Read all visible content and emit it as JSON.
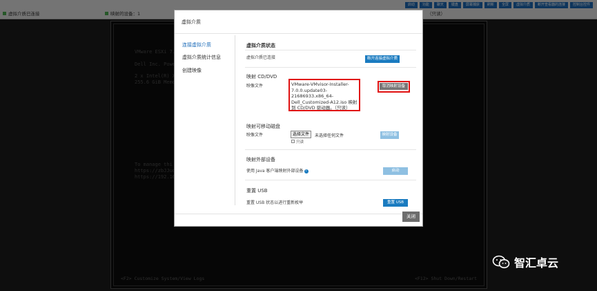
{
  "topbar": {
    "status_media": "虚拟介质已连接",
    "status_devices": "映射的设备：1",
    "status_extra": "（只读）",
    "buttons": [
      "启动",
      "功能",
      "聊天",
      "键盘",
      "屏幕捕获",
      "刷新",
      "全屏",
      "虚拟介质",
      "断开查看器的连接",
      "控制台控件"
    ]
  },
  "console": {
    "lines": [
      "VMware ESXi 7.",
      "",
      "Dell Inc. Powe",
      "",
      "2 x Intel(R) X",
      "255.6 GiB Memo"
    ],
    "manage_lines": [
      "To manage thi",
      "https://zbJJuq",
      "https://192.16"
    ],
    "footer_left": "<F2> Customize System/View Logs",
    "footer_right": "<F12> Shut Down/Restart"
  },
  "modal": {
    "title": "虚拟介质",
    "sidebar": {
      "items": [
        {
          "label": "连接虚拟介质",
          "active": true
        },
        {
          "label": "虚拟介质统计信息",
          "active": false
        },
        {
          "label": "创建映像",
          "active": false
        }
      ]
    },
    "status_section": {
      "title": "虚拟介质状态",
      "label": "虚拟介质已连接",
      "button": "断开连接虚拟介质"
    },
    "cd_section": {
      "title": "映射 CD/DVD",
      "image_label": "映像文件",
      "image_path": "VMware-VMvisor-Installer-7.0.0.update03-21686933.x86_64-Dell_Customized-A12.iso 映射到 CD/DVD 驱动器。（只读）",
      "unmap_button": "取消映射设备"
    },
    "removable_section": {
      "title": "映射可移动磁盘",
      "image_label": "映像文件",
      "choose_file": "选择文件",
      "no_file": "未选择任何文件",
      "readonly": "只读",
      "map_button": "映射设备"
    },
    "external_section": {
      "title": "映射外部设备",
      "label": "使用 Java 客户端映射外部设备",
      "button": "启动"
    },
    "usb_section": {
      "title": "重置 USB",
      "label": "重置 USB 状态以进行重新枚举",
      "button": "重置 USB"
    },
    "close_button": "关闭"
  },
  "watermark": {
    "text": "智汇卓云",
    "icon": "wechat-icon"
  },
  "colors": {
    "accent": "#1a7bc0",
    "highlight": "#e01010",
    "status_green": "#4caf50"
  }
}
